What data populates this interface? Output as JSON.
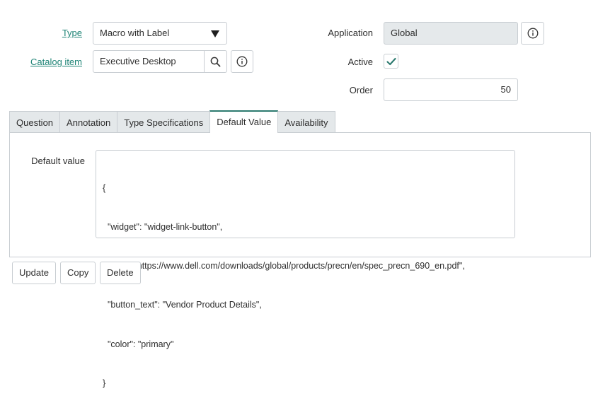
{
  "form": {
    "type": {
      "label": "Type",
      "value": "Macro with Label"
    },
    "catalog_item": {
      "label": "Catalog item",
      "value": "Executive Desktop"
    },
    "application": {
      "label": "Application",
      "value": "Global"
    },
    "active": {
      "label": "Active",
      "checked": true
    },
    "order": {
      "label": "Order",
      "value": "50"
    }
  },
  "tabs": [
    {
      "label": "Question",
      "active": false
    },
    {
      "label": "Annotation",
      "active": false
    },
    {
      "label": "Type Specifications",
      "active": false
    },
    {
      "label": "Default Value",
      "active": true
    },
    {
      "label": "Availability",
      "active": false
    }
  ],
  "default_value": {
    "label": "Default value",
    "lines": [
      "{",
      "  \"widget\": \"widget-link-button\",",
      "  \"href\": \"https://www.dell.com/downloads/global/products/precn/en/spec_precn_690_en.pdf\",",
      "  \"button_text\": \"Vendor Product Details\",",
      "  \"color\": \"primary\"",
      "}"
    ]
  },
  "actions": {
    "update": "Update",
    "copy": "Copy",
    "delete": "Delete"
  },
  "colors": {
    "accent": "#2c7a6f",
    "link": "#1f8476",
    "readonly_bg": "#e5e9eb",
    "border": "#c8cdd2"
  }
}
